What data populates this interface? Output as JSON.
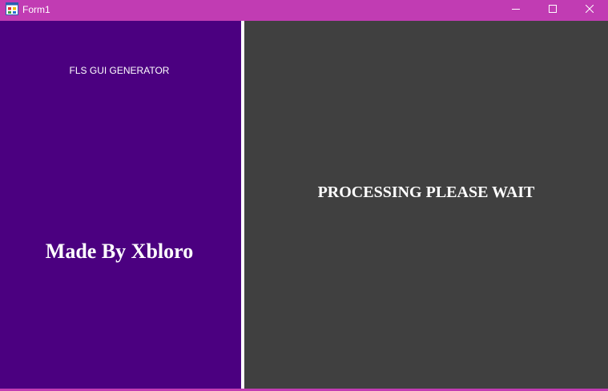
{
  "window": {
    "title": "Form1",
    "icon": "winforms-app-icon",
    "controls": {
      "minimize_icon": "minimize-icon",
      "maximize_icon": "maximize-icon",
      "close_icon": "close-icon"
    }
  },
  "left_panel": {
    "header_label": "FLS GUI GENERATOR",
    "credit_label": "Made By Xbloro",
    "background_color": "#4b0080"
  },
  "right_panel": {
    "status_label": "PROCESSING PLEASE WAIT",
    "background_color": "#404040"
  },
  "colors": {
    "titlebar": "#c13cb3",
    "text": "#ffffff",
    "divider": "#ffffff"
  }
}
